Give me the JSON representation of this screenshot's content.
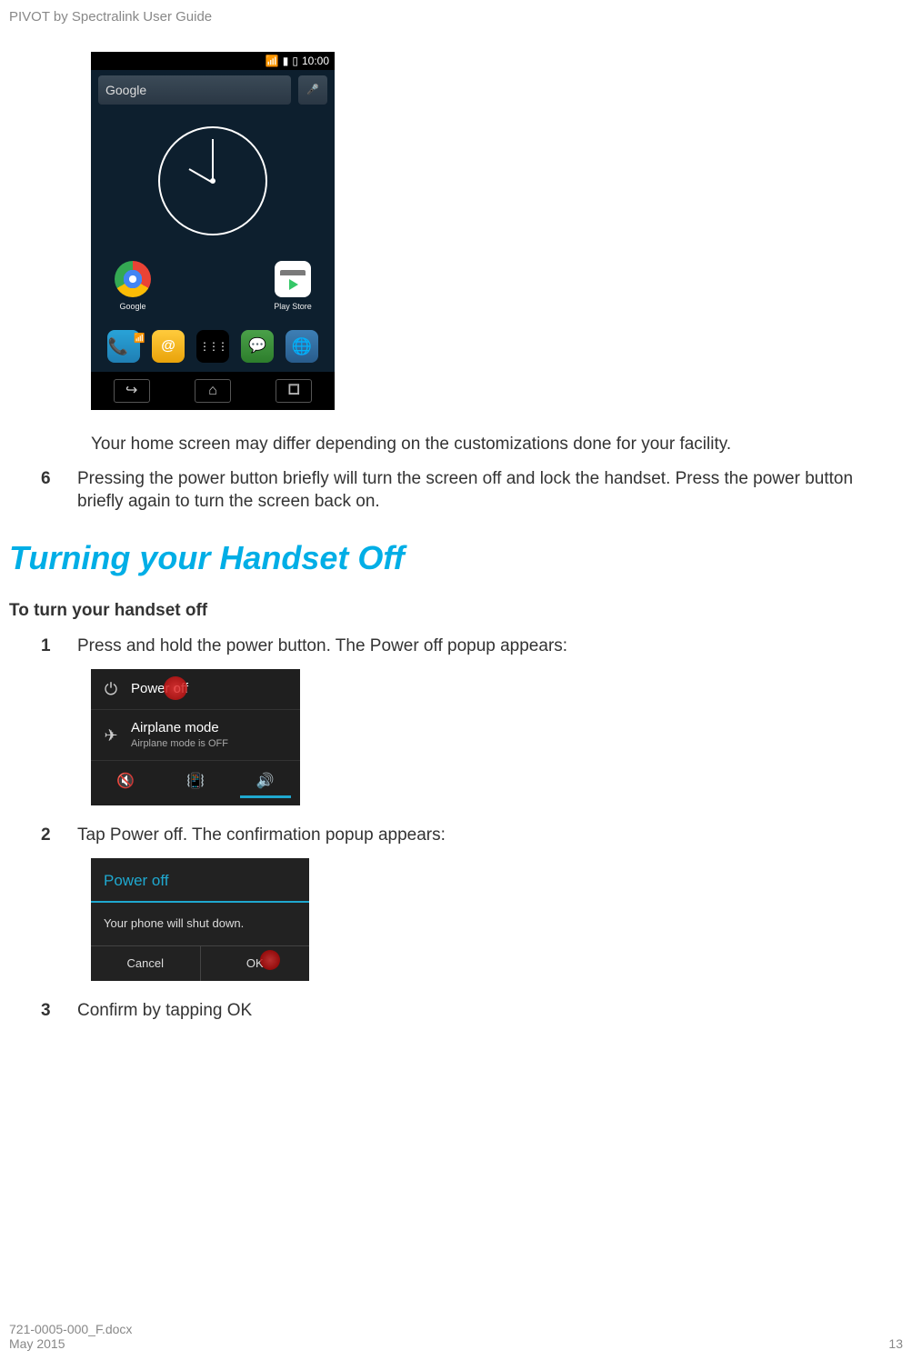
{
  "header": {
    "title": "PIVOT by Spectralink User Guide"
  },
  "homescreen": {
    "status": {
      "time": "10:00"
    },
    "search": {
      "label": "Google"
    },
    "apps": {
      "google": "Google",
      "playstore": "Play Store"
    }
  },
  "body": {
    "home_note": "Your home screen may differ depending on the customizations done for your facility.",
    "step6_num": "6",
    "step6_text": "Pressing the power button briefly will turn the screen off and lock the handset. Press the power button briefly again to turn the screen back on."
  },
  "section": {
    "title": "Turning your Handset Off",
    "subheading": "To turn your handset off",
    "step1_num": "1",
    "step1_text": "Press and hold the power button. The Power off popup appears:",
    "step2_num": "2",
    "step2_text": "Tap Power off. The confirmation popup appears:",
    "step3_num": "3",
    "step3_text": "Confirm by tapping OK"
  },
  "popup1": {
    "row1": "Power off",
    "row2_t1": "Airplane mode",
    "row2_t2": "Airplane mode is OFF"
  },
  "popup2": {
    "title": "Power off",
    "msg": "Your phone will shut down.",
    "cancel": "Cancel",
    "ok": "OK"
  },
  "footer": {
    "doc": "721-0005-000_F.docx",
    "date": "May 2015",
    "page": "13"
  }
}
